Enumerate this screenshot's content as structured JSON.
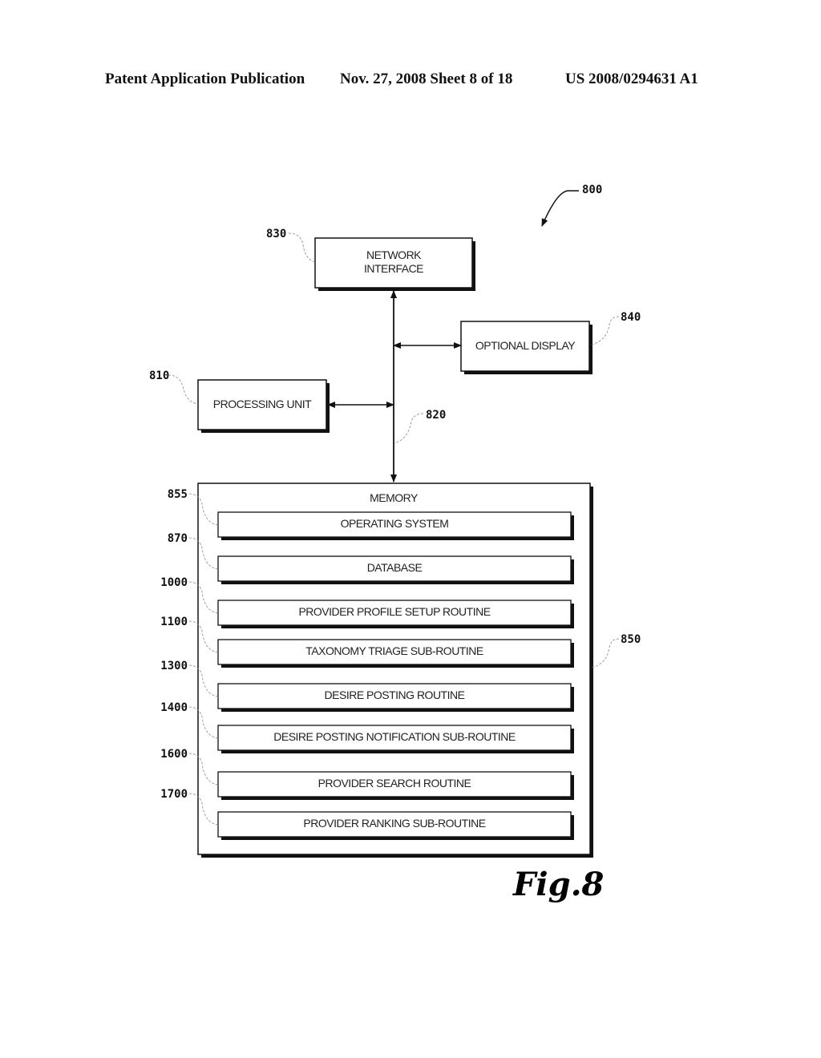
{
  "header": {
    "left": "Patent Application Publication",
    "center": "Nov. 27, 2008  Sheet 8 of 18",
    "right": "US 2008/0294631 A1"
  },
  "diagram": {
    "system_ref": "800",
    "bus_ref": "820",
    "blocks": {
      "network_interface": {
        "ref": "830",
        "line1": "NETWORK",
        "line2": "INTERFACE"
      },
      "optional_display": {
        "ref": "840",
        "label": "OPTIONAL DISPLAY"
      },
      "processing_unit": {
        "ref": "810",
        "label": "PROCESSING UNIT"
      },
      "memory": {
        "ref": "850",
        "label": "MEMORY"
      }
    },
    "memory_items": [
      {
        "ref": "855",
        "label": "OPERATING SYSTEM"
      },
      {
        "ref": "870",
        "label": "DATABASE"
      },
      {
        "ref": "1000",
        "label": "PROVIDER PROFILE SETUP ROUTINE"
      },
      {
        "ref": "1100",
        "label": "TAXONOMY TRIAGE SUB-ROUTINE"
      },
      {
        "ref": "1300",
        "label": "DESIRE POSTING ROUTINE"
      },
      {
        "ref": "1400",
        "label": "DESIRE POSTING NOTIFICATION SUB-ROUTINE"
      },
      {
        "ref": "1600",
        "label": "PROVIDER SEARCH ROUTINE"
      },
      {
        "ref": "1700",
        "label": "PROVIDER RANKING SUB-ROUTINE"
      }
    ]
  },
  "figure_label": "Fig.8"
}
